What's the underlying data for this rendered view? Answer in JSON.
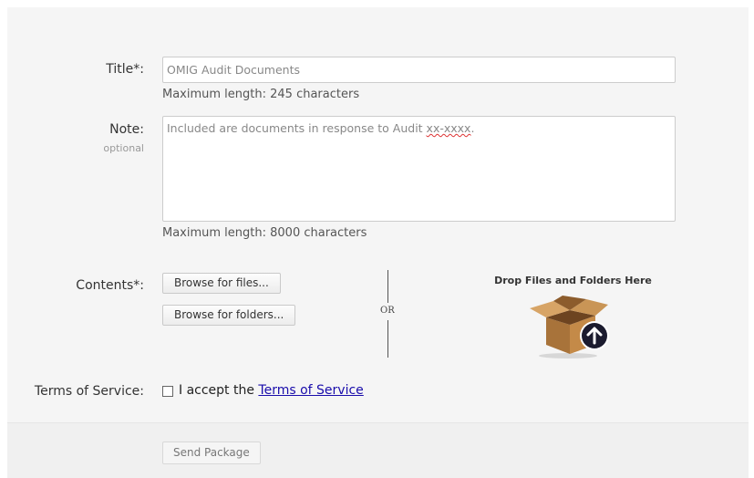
{
  "form": {
    "title": {
      "label": "Title*:",
      "value": "OMIG Audit Documents",
      "hint": "Maximum length: 245 characters"
    },
    "note": {
      "label": "Note:",
      "sublabel": "optional",
      "value_prefix": "Included are documents in response to Audit ",
      "value_misspelled": "xx-xxxx",
      "value_suffix": ".",
      "hint": "Maximum length: 8000 characters"
    },
    "contents": {
      "label": "Contents*:",
      "browse_files_label": "Browse for files...",
      "browse_folders_label": "Browse for folders...",
      "or_label": "OR",
      "drop_title": "Drop Files and Folders Here",
      "drop_icon": "box-upload-icon"
    },
    "tos": {
      "label": "Terms of Service:",
      "checked": false,
      "text_prefix": "I accept the ",
      "link_text": "Terms of Service"
    },
    "send_label": "Send Package"
  },
  "colors": {
    "panel_bg": "#f5f5f5",
    "link": "#1a0dab",
    "box_brown": "#b07a3c",
    "upload_circle": "#1b1b2e"
  }
}
